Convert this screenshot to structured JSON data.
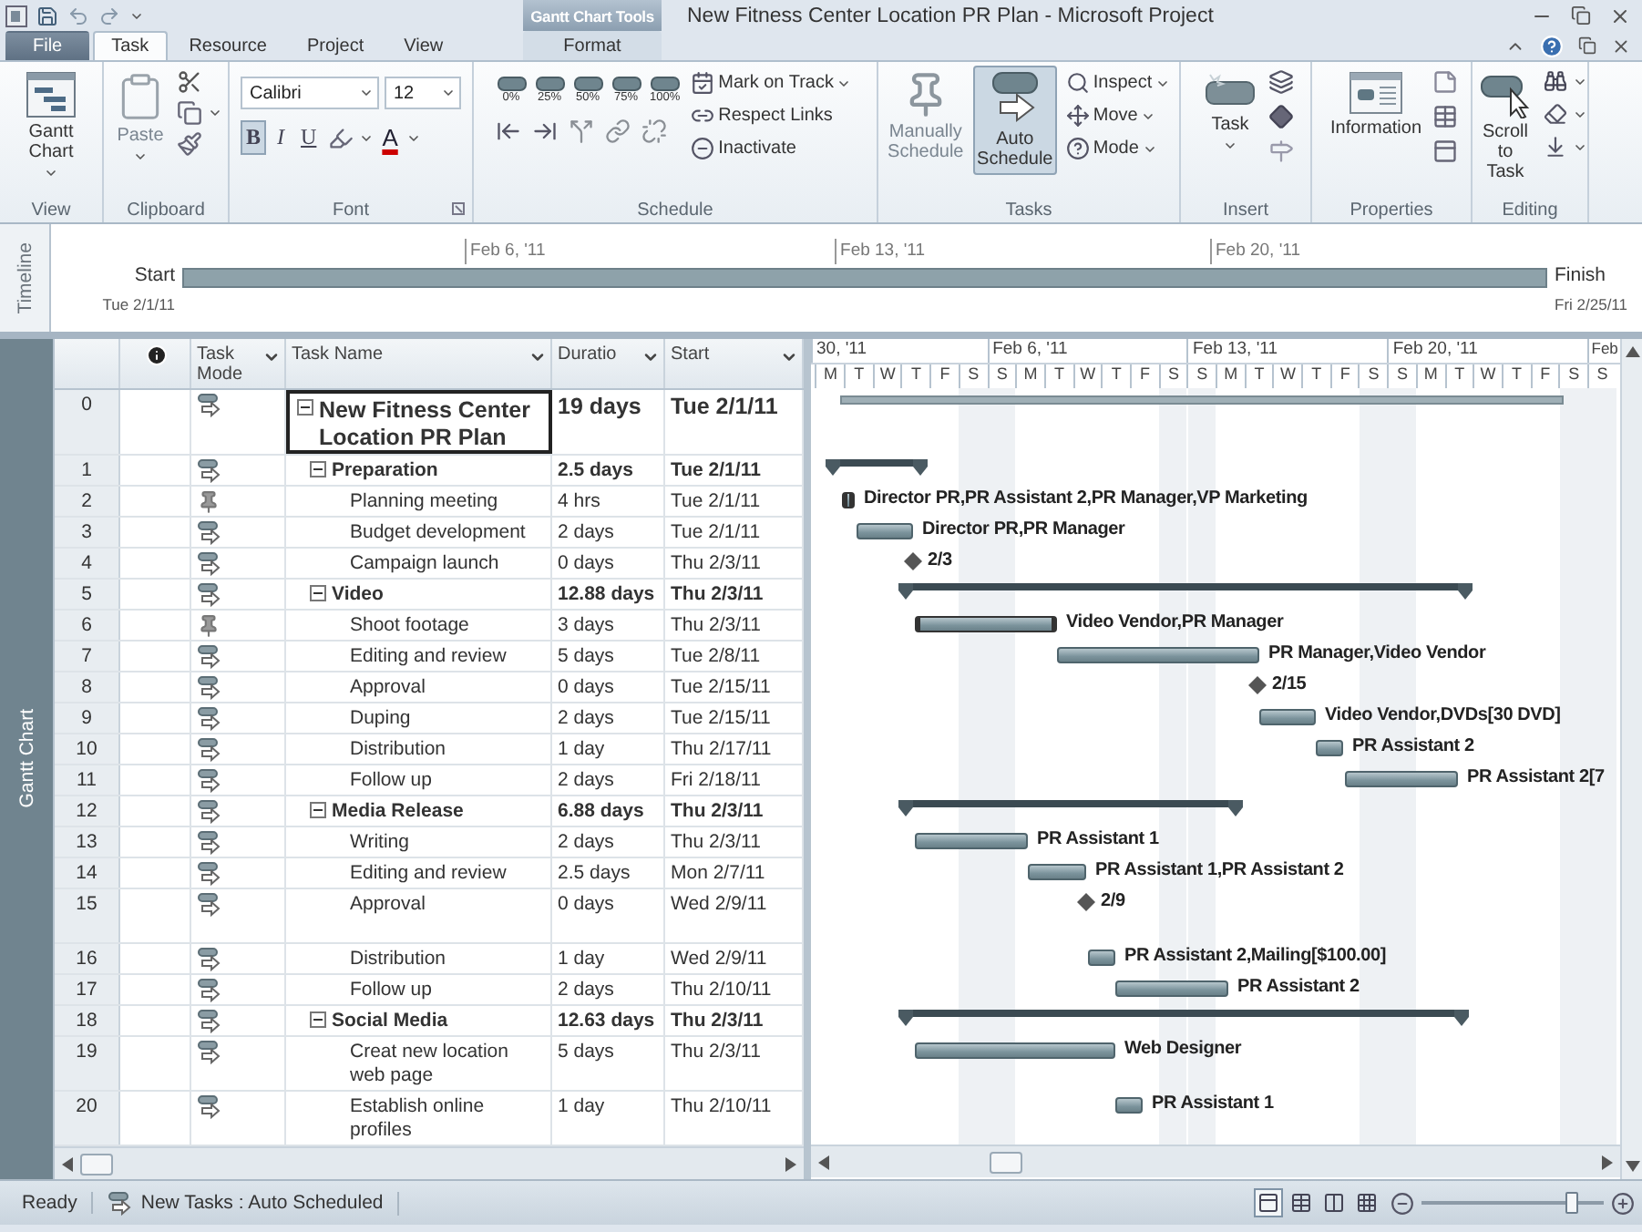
{
  "title_bar": {
    "contextual_group": "Gantt Chart Tools",
    "title": "New Fitness Center Location PR Plan - Microsoft Project"
  },
  "tabs": [
    {
      "label": "File",
      "kind": "file",
      "selected": false
    },
    {
      "label": "Task",
      "kind": "tab",
      "selected": true
    },
    {
      "label": "Resource",
      "kind": "tab",
      "selected": false
    },
    {
      "label": "Project",
      "kind": "tab",
      "selected": false
    },
    {
      "label": "View",
      "kind": "tab",
      "selected": false
    },
    {
      "label": "Format",
      "kind": "contextual",
      "selected": false
    }
  ],
  "ribbon": {
    "groups": [
      {
        "kind": "view",
        "label": "View",
        "button": "Gantt Chart"
      },
      {
        "kind": "clipboard",
        "label": "Clipboard",
        "button": "Paste"
      },
      {
        "kind": "font",
        "label": "Font",
        "font": "Calibri",
        "size": "12",
        "styles": [
          {
            "label": "B",
            "selected": true
          },
          {
            "label": "I",
            "selected": false
          },
          {
            "label": "U",
            "selected": false
          }
        ],
        "color_letter": "A"
      },
      {
        "kind": "schedule",
        "label": "Schedule",
        "percent": [
          "0%",
          "25%",
          "50%",
          "75%",
          "100%"
        ],
        "commands": [
          {
            "label": "Mark on Track",
            "menu": true
          },
          {
            "label": "Respect Links",
            "menu": false
          },
          {
            "label": "Inactivate",
            "menu": false
          }
        ]
      },
      {
        "kind": "tasks",
        "label": "Tasks",
        "modes": [
          {
            "label": "Manually Schedule",
            "selected": false
          },
          {
            "label": "Auto Schedule",
            "selected": true
          }
        ],
        "commands": [
          {
            "label": "Inspect",
            "menu": true
          },
          {
            "label": "Move",
            "menu": true
          },
          {
            "label": "Mode",
            "menu": true
          }
        ]
      },
      {
        "kind": "insert",
        "label": "Insert",
        "button": "Task"
      },
      {
        "kind": "properties",
        "label": "Properties",
        "button": "Information"
      },
      {
        "kind": "editing",
        "label": "Editing",
        "button": "Scroll to Task"
      }
    ]
  },
  "timeline": {
    "label": "Timeline",
    "start_label": "Start",
    "start_date": "Tue 2/1/11",
    "finish_label": "Finish",
    "finish_date": "Fri 2/25/11",
    "ticks": [
      "Feb 6, '11",
      "Feb 13, '11",
      "Feb 20, '11"
    ]
  },
  "table": {
    "view_label": "Gantt Chart",
    "columns": [
      {
        "kind": "info"
      },
      {
        "kind": "text",
        "label": "Task Mode",
        "menu": true
      },
      {
        "kind": "text",
        "label": "Task Name",
        "menu": true
      },
      {
        "kind": "text",
        "label": "Duratio",
        "menu": true
      },
      {
        "kind": "text",
        "label": "Start",
        "menu": true
      }
    ],
    "tasks": [
      {
        "id": "0",
        "manual": false,
        "kind": "project",
        "name": "New Fitness Center Location PR Plan",
        "duration": "19 days",
        "start": "Tue 2/1/11",
        "selected": true,
        "expanded": true,
        "children": [
          {
            "id": "1",
            "manual": false,
            "kind": "summary",
            "name": "Preparation",
            "duration": "2.5 days",
            "start": "Tue 2/1/11",
            "selected": false,
            "expanded": true,
            "children": [
              {
                "id": "2",
                "manual": true,
                "kind": "task",
                "name": "Planning meeting",
                "duration": "4 hrs",
                "start": "Tue 2/1/11",
                "selected": false,
                "bar_label": "Director PR,PR Assistant 2,PR Manager,VP Marketing"
              },
              {
                "id": "3",
                "manual": false,
                "kind": "task",
                "name": "Budget development",
                "duration": "2 days",
                "start": "Tue 2/1/11",
                "selected": false,
                "bar_label": "Director PR,PR Manager"
              },
              {
                "id": "4",
                "manual": false,
                "kind": "milestone",
                "name": "Campaign launch",
                "duration": "0 days",
                "start": "Thu 2/3/11",
                "selected": false,
                "bar_label": "2/3"
              }
            ]
          },
          {
            "id": "5",
            "manual": false,
            "kind": "summary",
            "name": "Video",
            "duration": "12.88 days",
            "start": "Thu 2/3/11",
            "selected": false,
            "expanded": true,
            "children": [
              {
                "id": "6",
                "manual": true,
                "kind": "task",
                "name": "Shoot footage",
                "duration": "3 days",
                "start": "Thu 2/3/11",
                "selected": false,
                "bar_label": "Video Vendor,PR Manager"
              },
              {
                "id": "7",
                "manual": false,
                "kind": "task",
                "name": "Editing and review",
                "duration": "5 days",
                "start": "Tue 2/8/11",
                "selected": false,
                "bar_label": "PR Manager,Video Vendor"
              },
              {
                "id": "8",
                "manual": false,
                "kind": "milestone",
                "name": "Approval",
                "duration": "0 days",
                "start": "Tue 2/15/11",
                "selected": false,
                "bar_label": "2/15"
              },
              {
                "id": "9",
                "manual": false,
                "kind": "task",
                "name": "Duping",
                "duration": "2 days",
                "start": "Tue 2/15/11",
                "selected": false,
                "bar_label": "Video Vendor,DVDs[30 DVD]"
              },
              {
                "id": "10",
                "manual": false,
                "kind": "task",
                "name": "Distribution",
                "duration": "1 day",
                "start": "Thu 2/17/11",
                "selected": false,
                "bar_label": "PR Assistant 2"
              },
              {
                "id": "11",
                "manual": false,
                "kind": "task",
                "name": "Follow up",
                "duration": "2 days",
                "start": "Fri 2/18/11",
                "selected": false,
                "bar_label": "PR Assistant 2[7"
              }
            ]
          },
          {
            "id": "12",
            "manual": false,
            "kind": "summary",
            "name": "Media Release",
            "duration": "6.88 days",
            "start": "Thu 2/3/11",
            "selected": false,
            "expanded": true,
            "children": [
              {
                "id": "13",
                "manual": false,
                "kind": "task",
                "name": "Writing",
                "duration": "2 days",
                "start": "Thu 2/3/11",
                "selected": false,
                "bar_label": "PR Assistant 1"
              },
              {
                "id": "14",
                "manual": false,
                "kind": "task",
                "name": "Editing and review",
                "duration": "2.5 days",
                "start": "Mon 2/7/11",
                "selected": false,
                "bar_label": "PR Assistant 1,PR Assistant 2"
              },
              {
                "id": "15",
                "manual": false,
                "kind": "milestone",
                "name": "Approval",
                "duration": "0 days",
                "start": "Wed 2/9/11",
                "selected": false,
                "bar_label": "2/9"
              },
              {
                "id": "16",
                "manual": false,
                "kind": "task",
                "name": "Distribution",
                "duration": "1 day",
                "start": "Wed 2/9/11",
                "selected": false,
                "bar_label": "PR Assistant 2,Mailing[$100.00]"
              },
              {
                "id": "17",
                "manual": false,
                "kind": "task",
                "name": "Follow up",
                "duration": "2 days",
                "start": "Thu 2/10/11",
                "selected": false,
                "bar_label": "PR Assistant 2"
              }
            ]
          },
          {
            "id": "18",
            "manual": false,
            "kind": "summary",
            "name": "Social Media",
            "duration": "12.63 days",
            "start": "Thu 2/3/11",
            "selected": false,
            "expanded": true,
            "children": [
              {
                "id": "19",
                "manual": false,
                "kind": "task",
                "name": "Creat new location web page",
                "duration": "5 days",
                "start": "Thu 2/3/11",
                "selected": false,
                "bar_label": "Web Designer"
              },
              {
                "id": "20",
                "manual": false,
                "kind": "task",
                "name": "Establish online profiles",
                "duration": "1 day",
                "start": "Thu 2/10/11",
                "selected": false,
                "bar_label": "PR Assistant 1"
              }
            ]
          }
        ]
      }
    ]
  },
  "gantt": {
    "weeks": [
      "30, '11",
      "Feb 6, '11",
      "Feb 13, '11",
      "Feb 20, '11",
      "Feb"
    ],
    "days": [
      {
        "label": "M",
        "weekend": false
      },
      {
        "label": "T",
        "weekend": false
      },
      {
        "label": "W",
        "weekend": false
      },
      {
        "label": "T",
        "weekend": false
      },
      {
        "label": "F",
        "weekend": false
      },
      {
        "label": "S",
        "weekend": true
      },
      {
        "label": "S",
        "weekend": true
      },
      {
        "label": "M",
        "weekend": false
      },
      {
        "label": "T",
        "weekend": false
      },
      {
        "label": "W",
        "weekend": false
      },
      {
        "label": "T",
        "weekend": false
      },
      {
        "label": "F",
        "weekend": false
      },
      {
        "label": "S",
        "weekend": true
      },
      {
        "label": "S",
        "weekend": true
      },
      {
        "label": "M",
        "weekend": false
      },
      {
        "label": "T",
        "weekend": false
      },
      {
        "label": "W",
        "weekend": false
      },
      {
        "label": "T",
        "weekend": false
      },
      {
        "label": "F",
        "weekend": false
      },
      {
        "label": "S",
        "weekend": true
      },
      {
        "label": "S",
        "weekend": true
      },
      {
        "label": "M",
        "weekend": false
      },
      {
        "label": "T",
        "weekend": false
      },
      {
        "label": "W",
        "weekend": false
      },
      {
        "label": "T",
        "weekend": false
      },
      {
        "label": "F",
        "weekend": false
      },
      {
        "label": "S",
        "weekend": true
      },
      {
        "label": "S",
        "weekend": true
      }
    ]
  },
  "status_bar": {
    "ready": "Ready",
    "new_tasks": "New Tasks : Auto Scheduled",
    "views": [
      {
        "selected": true
      },
      {
        "selected": false
      },
      {
        "selected": false
      },
      {
        "selected": false
      }
    ],
    "zoom": {
      "level": 0.82
    }
  }
}
